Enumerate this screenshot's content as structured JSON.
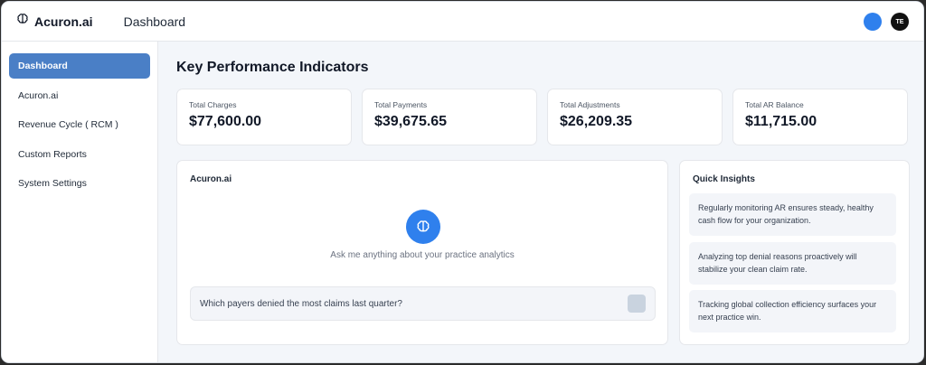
{
  "header": {
    "brand": "Acuron.ai",
    "page_title": "Dashboard",
    "avatar_initials": "TE",
    "icons": {
      "brand": "brain-icon",
      "status": "blue-dot"
    }
  },
  "sidebar": {
    "items": [
      {
        "label": "Dashboard",
        "active": true
      },
      {
        "label": "Acuron.ai"
      },
      {
        "label": "Revenue Cycle ( RCM )"
      },
      {
        "label": "Custom Reports"
      },
      {
        "label": "System Settings"
      }
    ]
  },
  "main": {
    "title": "Key Performance Indicators",
    "kpis": [
      {
        "label": "Total Charges",
        "value": "$77,600.00"
      },
      {
        "label": "Total Payments",
        "value": "$39,675.65"
      },
      {
        "label": "Total Adjustments",
        "value": "$26,209.35"
      },
      {
        "label": "Total AR Balance",
        "value": "$11,715.00"
      }
    ],
    "assistant": {
      "title": "Acuron.ai",
      "hint": "Ask me anything about your practice analytics",
      "input_value": "Which payers denied the most claims last quarter?"
    },
    "insights": {
      "title": "Quick Insights",
      "items": [
        "Regularly monitoring AR ensures steady, healthy cash flow for your organization.",
        "Analyzing top denial reasons proactively will stabilize your clean claim rate.",
        "Tracking global collection efficiency surfaces your next practice win."
      ]
    }
  },
  "colors": {
    "accent": "#2f80ed",
    "active_nav": "#4a7fc6",
    "background": "#f3f6fa"
  }
}
